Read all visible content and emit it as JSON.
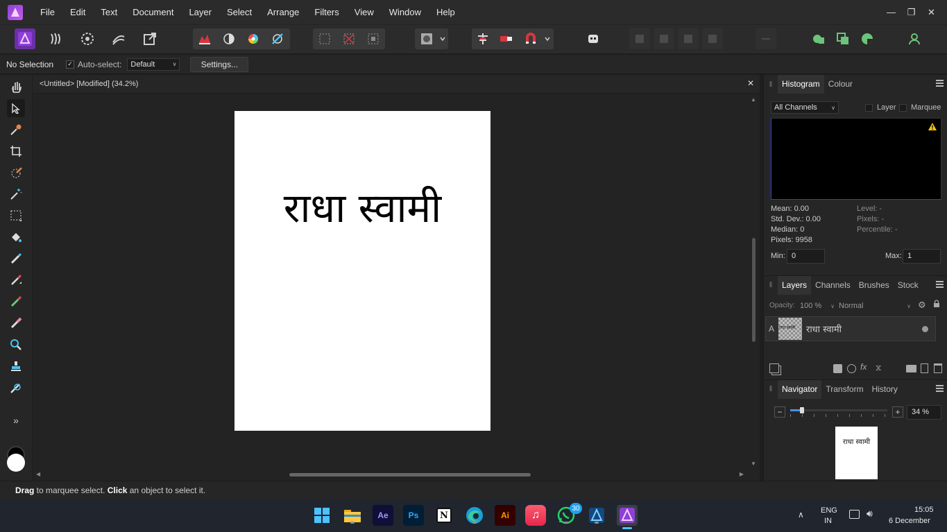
{
  "menu": [
    "File",
    "Edit",
    "Text",
    "Document",
    "Layer",
    "Select",
    "Arrange",
    "Filters",
    "View",
    "Window",
    "Help"
  ],
  "context": {
    "selection": "No Selection",
    "autoselect_label": "Auto-select:",
    "autoselect_value": "Default",
    "settings_button": "Settings..."
  },
  "document": {
    "tab_title": "<Untitled> [Modified] (34.2%)",
    "page_text": "राधा स्वामी"
  },
  "histogram": {
    "tabs": [
      "Histogram",
      "Colour"
    ],
    "channel": "All Channels",
    "layer_label": "Layer",
    "marquee_label": "Marquee",
    "mean": "Mean: 0.00",
    "std_dev": "Std. Dev.: 0.00",
    "median": "Median: 0",
    "pixels": "Pixels: 9958",
    "level": "Level: -",
    "pixels_right": "Pixels: -",
    "percentile": "Percentile: -",
    "min_label": "Min:",
    "min_value": "0",
    "max_label": "Max:",
    "max_value": "1"
  },
  "layers": {
    "tabs": [
      "Layers",
      "Channels",
      "Brushes",
      "Stock"
    ],
    "opacity_label": "Opacity:",
    "opacity_value": "100 %",
    "blend_mode": "Normal",
    "layer_type": "A",
    "layer_name": "राधा स्वामी",
    "thumb_text": "राधा स्वामी"
  },
  "navigator": {
    "tabs": [
      "Navigator",
      "Transform",
      "History"
    ],
    "zoom_value": "34 %",
    "zoom_fraction": 0.1,
    "preview_text": "राधा स्वामी"
  },
  "status": {
    "drag": "Drag",
    "drag_rest": " to marquee select. ",
    "click": "Click",
    "click_rest": " an object to select it."
  },
  "taskbar": {
    "apps": [
      "Ae",
      "Ps",
      "Ai"
    ],
    "whatsapp_badge": "30",
    "lang_top": "ENG",
    "lang_bottom": "IN",
    "time": "15:05",
    "date": "6 December"
  },
  "colors": {
    "accent": "#8e3fd6",
    "histogram_border": "#2b3cff",
    "warning": "#f5c518"
  }
}
